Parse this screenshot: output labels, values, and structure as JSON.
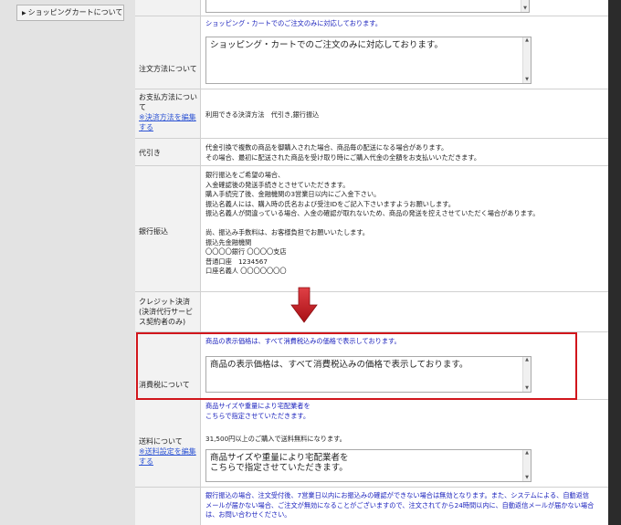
{
  "sidebar": {
    "items": [
      {
        "label": "ショッピングカートについて"
      }
    ]
  },
  "rows": {
    "order_method": {
      "label": "注文方法について",
      "text": "ショッピング・カートでのご注文のみに対応しております。",
      "textarea_value": "ショッピング・カートでのご注文のみに対応しております。"
    },
    "payment": {
      "label": "お支払方法について",
      "link": "※決済方法を編集する",
      "text": "利用できる決済方法　代引き,銀行振込"
    },
    "cod": {
      "label": "代引き",
      "lines": [
        "代金引換で複数の商品を御購入された場合、商品毎の配送になる場合があります。",
        "その場合、最初に配送された商品を受け取り時にご購入代金の全額をお支払いいただきます。"
      ]
    },
    "bank": {
      "label": "銀行振込",
      "lines": [
        "銀行振込をご希望の場合、",
        "入金確認後の発送手続きとさせていただきます。",
        "購入手続完了後、金融機関の3営業日以内にご入金下さい。",
        "振込名義人には、購入時の氏名および受注IDをご記入下さいますようお願いします。",
        "振込名義人が間違っている場合、入金の確認が取れないため、商品の発送を控えさせていただく場合があります。",
        "",
        "尚、振込み手数料は、お客様負担でお願いいたします。",
        "振込先金融機関",
        "〇〇〇〇銀行 〇〇〇〇支店",
        "普通口座　1234567",
        "口座名義人 〇〇〇〇〇〇〇"
      ]
    },
    "credit": {
      "label": "クレジット決済(決済代行サービス契約者のみ)"
    },
    "tax": {
      "label": "消費税について",
      "text": "商品の表示価格は、すべて消費税込みの価格で表示しております。",
      "textarea_value": "商品の表示価格は、すべて消費税込みの価格で表示しております。"
    },
    "shipping": {
      "label": "送料について",
      "link": "※送料設定を編集する",
      "text_lines": [
        "商品サイズや重量により宅配業者を",
        "こちらで指定させていただきます。"
      ],
      "note": "31,500円以上のご購入で送料無料になります。",
      "textarea_lines": [
        "商品サイズや重量により宅配業者を",
        "こちらで指定させていただきます。"
      ]
    },
    "cancel": {
      "lines": [
        "銀行振込の場合、注文受付後、7営業日以内にお振込みの確認ができない場合は無効となります。また、システムによる、自動返信",
        "メールが届かない場合、ご注文が無効になることがございますので、注文されてから24時間以内に、自動返信メールが届かない場合",
        "は、お問い合わせください。"
      ]
    }
  },
  "colors": {
    "highlight": "#d1161c",
    "arrow": "#c4161c",
    "info_text": "#1b22bd",
    "link": "#2f55d4"
  }
}
